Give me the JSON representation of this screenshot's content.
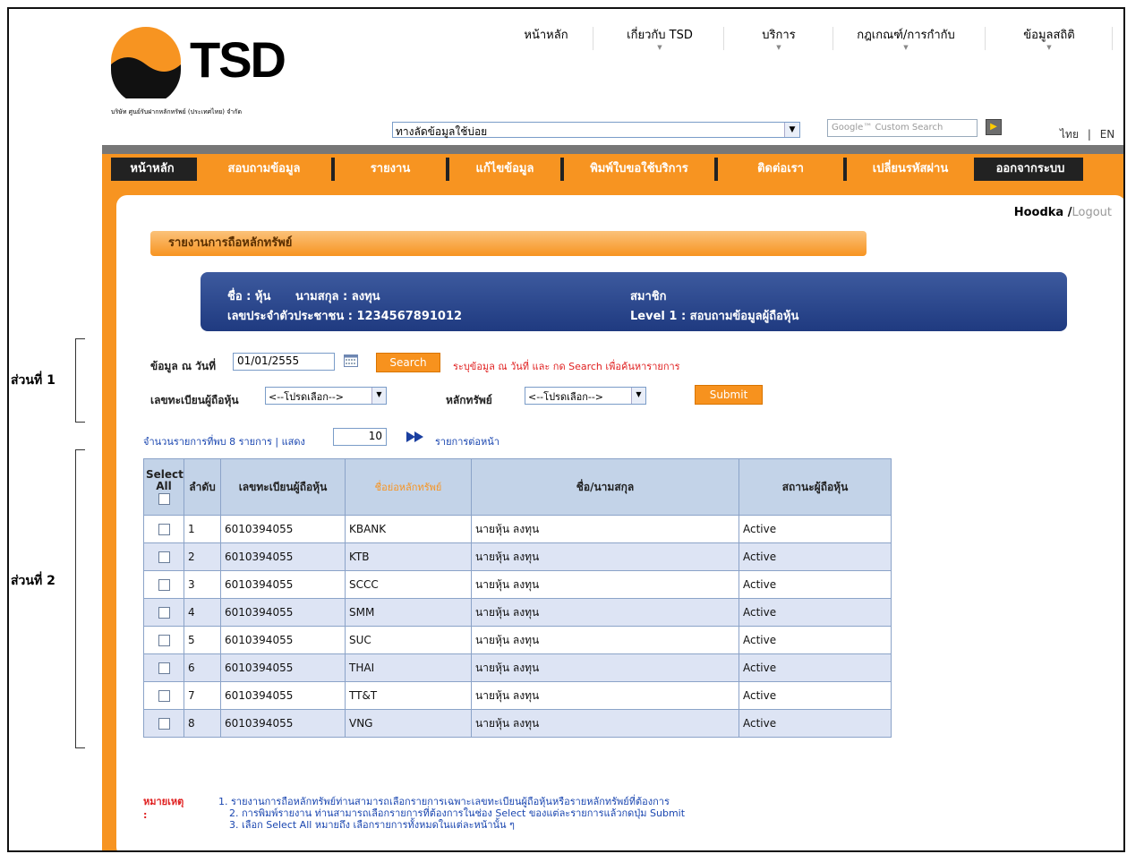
{
  "side": {
    "part1": "ส่วนที่ 1",
    "part2": "ส่วนที่ 2"
  },
  "logo": {
    "text": "TSD",
    "subtitle": "บริษัท ศูนย์รับฝากหลักทรัพย์ (ประเทศไทย) จำกัด"
  },
  "topnav": [
    "หน้าหลัก",
    "เกี่ยวกับ TSD",
    "บริการ",
    "กฎเกณฑ์/การกำกับ",
    "ข้อมูลสถิติ"
  ],
  "shortcut": {
    "value": "ทางลัดข้อมูลใช้บ่อย"
  },
  "gsearch": {
    "placeholder": "Google™ Custom Search"
  },
  "lang": {
    "th": "ไทย",
    "sep": "|",
    "en": "EN"
  },
  "mainnav": [
    "หน้าหลัก",
    "สอบถามข้อมูล",
    "รายงาน",
    "แก้ไขข้อมูล",
    "พิมพ์ใบขอใช้บริการ",
    "ติดต่อเรา",
    "เปลี่ยนรหัสผ่าน",
    "ออกจากระบบ"
  ],
  "user": {
    "name": "Hoodka",
    "sep": " /",
    "logout": "Logout"
  },
  "section_title": "รายงานการถือหลักทรัพย์",
  "info": {
    "name": "ชื่อ : หุ้น",
    "surname": "นามสกุล : ลงทุน",
    "id": "เลขประจำตัวประชาชน : 1234567891012",
    "member": "สมาชิก",
    "level": "Level 1  : สอบถามข้อมูลผู้ถือหุ้น"
  },
  "form": {
    "date_label": "ข้อมูล ณ วันที่",
    "date_value": "01/01/2555",
    "search_button": "Search",
    "hint": "ระบุข้อมูล ณ วันที่ และ กด Search เพื่อค้นหารายการ",
    "holder_label": "เลขทะเบียนผู้ถือหุ้น",
    "holder_select": "<--โปรดเลือก-->",
    "security_label": "หลักทรัพย์",
    "security_select": "<--โปรดเลือก-->",
    "submit_button": "Submit"
  },
  "paging": {
    "found": "จำนวนรายการที่พบ 8 รายการ | แสดง",
    "per_page": "10",
    "suffix": "รายการต่อหน้า"
  },
  "table": {
    "headers": [
      "Select All",
      "ลำดับ",
      "เลขทะเบียนผู้ถือหุ้น",
      "ชื่อย่อหลักทรัพย์",
      "ชื่อ/นามสกุล",
      "สถานะผู้ถือหุ้น"
    ],
    "rows": [
      [
        "1",
        "6010394055",
        "KBANK",
        "นายหุ้น ลงทุน",
        "Active"
      ],
      [
        "2",
        "6010394055",
        "KTB",
        "นายหุ้น ลงทุน",
        "Active"
      ],
      [
        "3",
        "6010394055",
        "SCCC",
        "นายหุ้น ลงทุน",
        "Active"
      ],
      [
        "4",
        "6010394055",
        "SMM",
        "นายหุ้น ลงทุน",
        "Active"
      ],
      [
        "5",
        "6010394055",
        "SUC",
        "นายหุ้น ลงทุน",
        "Active"
      ],
      [
        "6",
        "6010394055",
        "THAI",
        "นายหุ้น ลงทุน",
        "Active"
      ],
      [
        "7",
        "6010394055",
        "TT&T",
        "นายหุ้น ลงทุน",
        "Active"
      ],
      [
        "8",
        "6010394055",
        "VNG",
        "นายหุ้น ลงทุน",
        "Active"
      ]
    ]
  },
  "remark": {
    "key": "หมายเหตุ :",
    "lines": [
      "1. รายงานการถือหลักทรัพย์ท่านสามารถเลือกรายการเฉพาะเลขทะเบียนผู้ถือหุ้นหรือรายหลักทรัพย์ที่ต้องการ",
      "2. การพิมพ์รายงาน ท่านสามารถเลือกรายการที่ต้องการในช่อง Select ของแต่ละรายการแล้วกดปุ่ม Submit",
      "3. เลือก Select All หมายถึง เลือกรายการทั้งหมดในแต่ละหน้านั้น ๆ"
    ]
  },
  "colors": {
    "orange": "#f79421",
    "navy": "#1f3a80",
    "header_blue": "#c3d3e8",
    "row_alt": "#dde4f4"
  }
}
